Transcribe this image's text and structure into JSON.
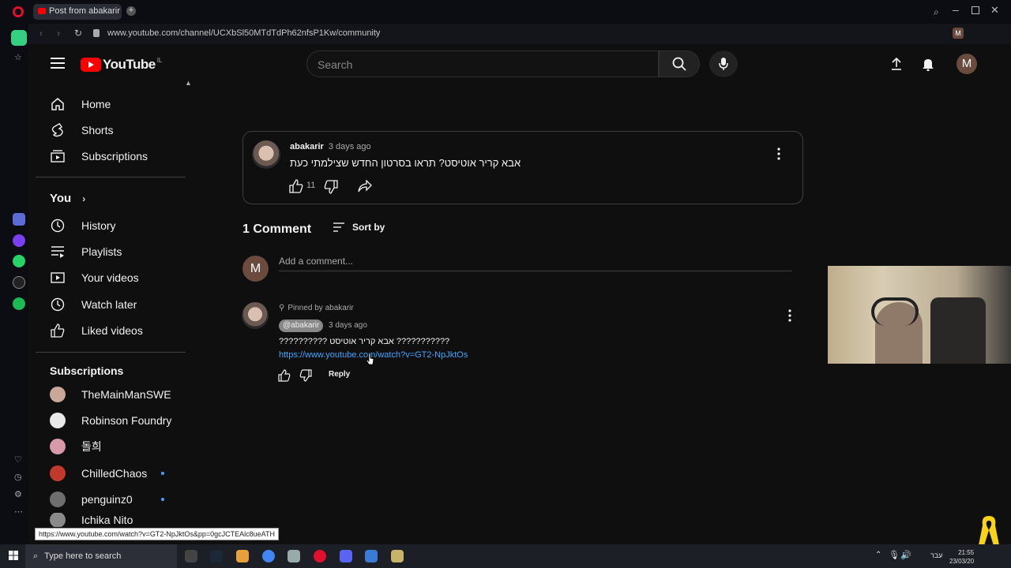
{
  "browser": {
    "tab_title": "Post from abakarir - YouT",
    "url": "www.youtube.com/channel/UCXbSl50MTdTdPh62nfsP1Kw/community",
    "profile_letter": "M",
    "status_url": "https://www.youtube.com/watch?v=GT2-NpJktOs&pp=0gcJCTEAlc8ueATH"
  },
  "header": {
    "logo_text": "YouTube",
    "country_code": "IL",
    "search_placeholder": "Search",
    "avatar_letter": "M"
  },
  "sidebar": {
    "main": [
      {
        "label": "Home",
        "icon": "home-icon"
      },
      {
        "label": "Shorts",
        "icon": "shorts-icon"
      },
      {
        "label": "Subscriptions",
        "icon": "subscriptions-icon"
      }
    ],
    "you_label": "You",
    "you_items": [
      {
        "label": "History",
        "icon": "history-icon"
      },
      {
        "label": "Playlists",
        "icon": "playlists-icon"
      },
      {
        "label": "Your videos",
        "icon": "your-videos-icon"
      },
      {
        "label": "Watch later",
        "icon": "watch-later-icon"
      },
      {
        "label": "Liked videos",
        "icon": "liked-videos-icon"
      }
    ],
    "subscriptions_title": "Subscriptions",
    "subscriptions": [
      {
        "name": "TheMainManSWE",
        "color": "#c9a89a",
        "new": false
      },
      {
        "name": "Robinson Foundry",
        "color": "#e8e8e8",
        "new": false
      },
      {
        "name": "돌희",
        "color": "#d89aa8",
        "new": false
      },
      {
        "name": "ChilledChaos",
        "color": "#c0392b",
        "new": true
      },
      {
        "name": "penguinz0",
        "color": "#6e6e6e",
        "new": true
      },
      {
        "name": "Ichika Nito",
        "color": "#8a8a8a",
        "new": true
      }
    ]
  },
  "post": {
    "author": "abakarir",
    "time": "3 days ago",
    "text": "אבא קריר אוטיסט? תראו בסרטון החדש שצילמתי כעת",
    "likes": "11"
  },
  "comments": {
    "count_label": "1 Comment",
    "sort_label": "Sort by",
    "add_placeholder": "Add a comment...",
    "user_letter": "M",
    "items": [
      {
        "pinned_label": "Pinned by abakarir",
        "author": "@abakarir",
        "time": "3 days ago",
        "text": "?????????? אבא קריר אוטיסט ???????????",
        "link": "https://www.youtube.com/watch?v=GT2-NpJktOs",
        "reply_label": "Reply"
      }
    ]
  },
  "taskbar": {
    "search_placeholder": "Type here to search",
    "time": "21:55",
    "date": "23/03/20",
    "lang": "עבר"
  },
  "colors": {
    "accent": "#3ea6ff",
    "youtube_red": "#ff0000",
    "avatar_bg": "#6b4b3e"
  }
}
